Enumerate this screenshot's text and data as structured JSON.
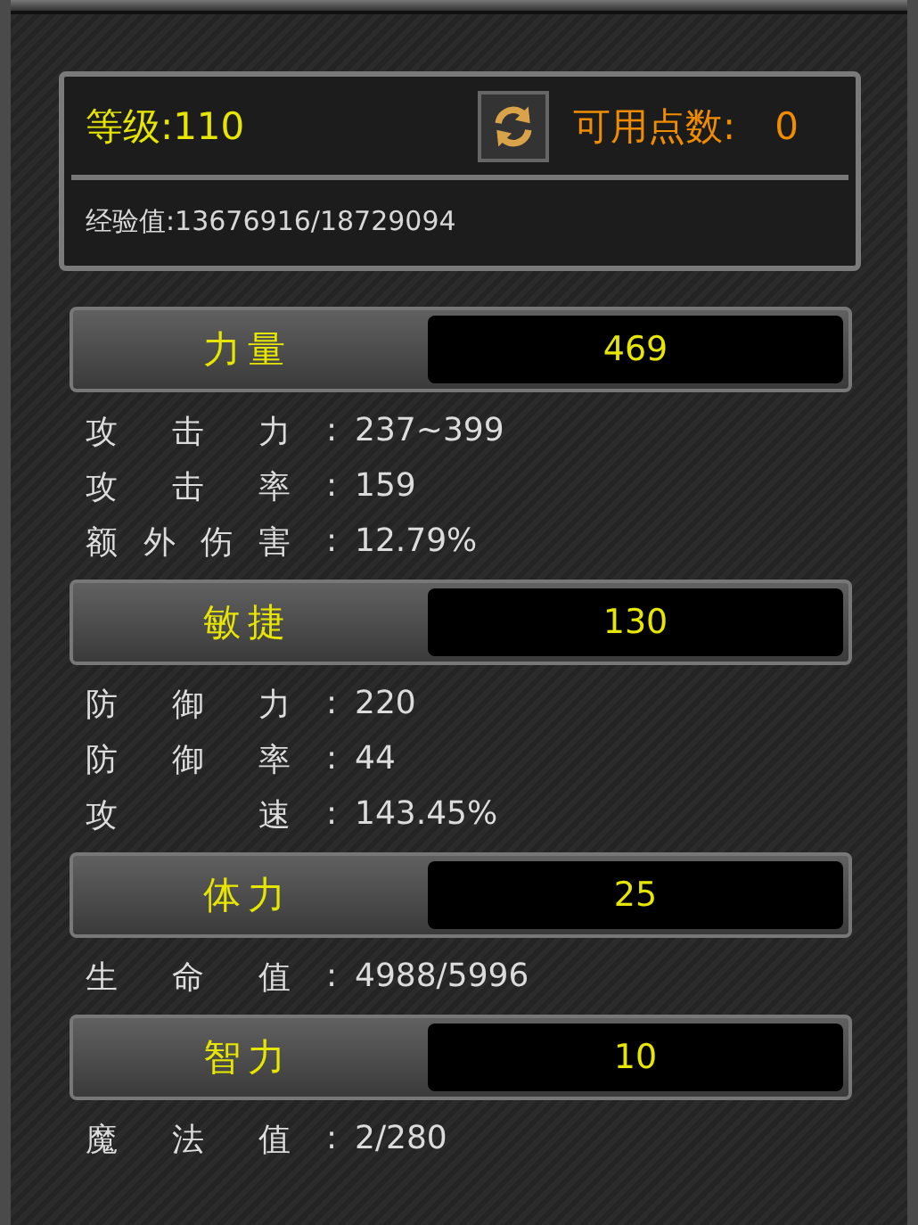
{
  "summary": {
    "level": "等级:110",
    "points_label": "可用点数:",
    "points": "0",
    "exp": "经验值:13676916/18729094"
  },
  "attributes": [
    {
      "name": "力量",
      "value": "469",
      "stats": [
        {
          "label": "攻 击 力",
          "colon": ":",
          "value": "237~399"
        },
        {
          "label": "攻 击 率",
          "colon": ":",
          "value": "159"
        },
        {
          "label": "额 外 伤 害",
          "colon": ":",
          "value": "12.79%"
        }
      ]
    },
    {
      "name": "敏捷",
      "value": "130",
      "stats": [
        {
          "label": "防 御 力",
          "colon": ":",
          "value": "220"
        },
        {
          "label": "防 御 率",
          "colon": ":",
          "value": "44"
        },
        {
          "label": "攻 速",
          "colon": ":",
          "value": "143.45%"
        }
      ]
    },
    {
      "name": "体力",
      "value": "25",
      "stats": [
        {
          "label": "生 命 值",
          "colon": ":",
          "value": "4988/5996"
        }
      ]
    },
    {
      "name": "智力",
      "value": "10",
      "stats": [
        {
          "label": "魔 法 值",
          "colon": ":",
          "value": "2/280"
        }
      ]
    }
  ]
}
